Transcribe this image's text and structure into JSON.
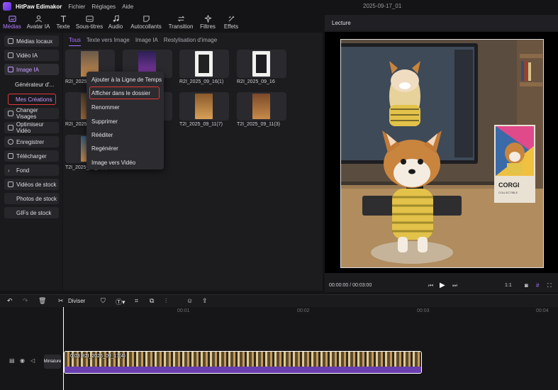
{
  "app": {
    "name": "HitPaw Edimakor",
    "menu": [
      "Fichier",
      "Réglages",
      "Aide"
    ],
    "date_title": "2025-09-17_01"
  },
  "toolbar": {
    "items": [
      {
        "label": "Médias",
        "icon": "media-icon"
      },
      {
        "label": "Avatar IA",
        "icon": "avatar-icon"
      },
      {
        "label": "Texte",
        "icon": "text-icon"
      },
      {
        "label": "Sous-titres",
        "icon": "subtitles-icon"
      },
      {
        "label": "Audio",
        "icon": "music-icon"
      },
      {
        "label": "Autocollants",
        "icon": "sticker-icon"
      },
      {
        "label": "Transition",
        "icon": "transition-icon"
      },
      {
        "label": "Filtres",
        "icon": "filter-icon"
      },
      {
        "label": "Effets",
        "icon": "effects-icon"
      }
    ],
    "active": "Médias"
  },
  "sidebar": {
    "medias_locaux": "Médias locaux",
    "video_ia": "Vidéo IA",
    "image_ia": "Image IA",
    "generateur": "Générateur d'...",
    "mes_creations": "Mes Créations",
    "changer_visages": "Changer Visages",
    "optimiseur": "Optimiseur Vidéo",
    "enregistrer": "Enregistrer",
    "telecharger": "Télécharger",
    "fond": "Fond",
    "videos_stock": "Vidéos de stock",
    "photos_stock": "Photos de stock",
    "gifs_stock": "GIFs de stock"
  },
  "media_tabs": [
    "Tous",
    "Texte vers Image",
    "Image IA",
    "Restylisation d'image"
  ],
  "media_items": {
    "r1a": "R2I_2025_09_...",
    "r1c": "R2I_2025_09_16(1)",
    "r1d": "R2I_2025_09_16",
    "r2a": "R2I_2025_...",
    "r2c": "T2I_2025_09_11(7)",
    "r2d": "T2I_2025_09_11(3)",
    "r3a": "T2I_2025_09_...(1)"
  },
  "context_menu": {
    "add_timeline": "Ajouter à la Ligne de Temps",
    "show_folder": "Afficher dans le dossier",
    "rename": "Renommer",
    "delete": "Supprimer",
    "reedit": "Rééditer",
    "regenerate": "Regénérer",
    "image_to_video": "Image vers Vidéo"
  },
  "preview": {
    "title": "Lecture",
    "timecode": "00:00:00 / 00:03:00",
    "ratio": "1:1",
    "poster_text": "CORGI",
    "poster_sub": "COLLECTIBLE"
  },
  "timeline": {
    "split_label": "Diviser",
    "ruler": [
      "00:01",
      "00:02",
      "00:03",
      "00:04"
    ],
    "track_label": "Miniature",
    "clip_label": "0:03 R2I_2025_09_17(4)"
  }
}
